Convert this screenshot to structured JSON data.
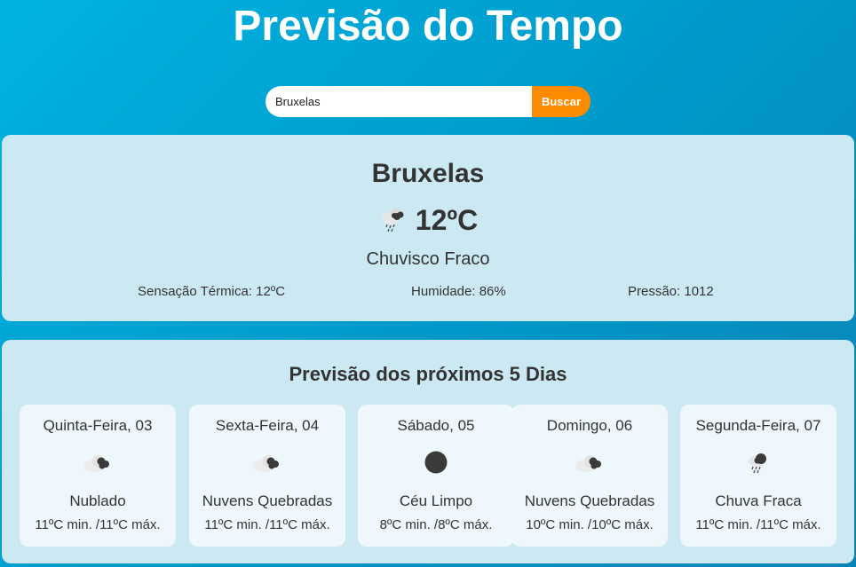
{
  "header": {
    "title": "Previsão do Tempo"
  },
  "search": {
    "value": "Bruxelas",
    "button_label": "Buscar"
  },
  "current": {
    "city": "Bruxelas",
    "icon": "drizzle-icon",
    "temperature": "12ºC",
    "description": "Chuvisco Fraco",
    "feels_like": "Sensação Térmica: 12ºC",
    "humidity": "Humidade: 86%",
    "pressure": "Pressão: 1012"
  },
  "forecast": {
    "title": "Previsão dos próximos 5 Dias",
    "days": [
      {
        "date": "Quinta-Feira, 03",
        "icon": "cloudy-icon",
        "description": "Nublado",
        "range": "11ºC min. /11ºC máx."
      },
      {
        "date": "Sexta-Feira, 04",
        "icon": "broken-clouds-icon",
        "description": "Nuvens Quebradas",
        "range": "11ºC min. /11ºC máx."
      },
      {
        "date": "Sábado, 05",
        "icon": "clear-sky-icon",
        "description": "Céu Limpo",
        "range": "8ºC min. /8ºC máx."
      },
      {
        "date": "Domingo, 06",
        "icon": "broken-clouds-icon",
        "description": "Nuvens Quebradas",
        "range": "10ºC min. /10ºC máx."
      },
      {
        "date": "Segunda-Feira, 07",
        "icon": "rain-icon",
        "description": "Chuva Fraca",
        "range": "11ºC min. /11ºC máx."
      }
    ]
  },
  "colors": {
    "accent": "#ff8c00",
    "background": "#00a5d6",
    "card": "#cce9f3",
    "day_card": "#eef7fb",
    "text": "#333333"
  }
}
